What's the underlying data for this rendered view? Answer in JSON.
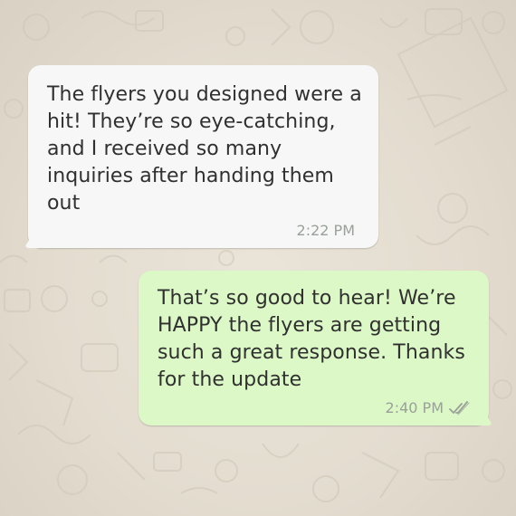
{
  "messages": [
    {
      "direction": "incoming",
      "text": "The flyers you designed were a hit! They’re so eye-catching, and I received so many inquiries after handing them out",
      "time": "2:22 PM"
    },
    {
      "direction": "outgoing",
      "text": "That’s so good to hear! We’re HAPPY the flyers are getting such a great response. Thanks for the update",
      "time": "2:40 PM",
      "status_icon": "double-check-icon"
    }
  ],
  "colors": {
    "incoming_bubble": "#f7f7f7",
    "outgoing_bubble": "#dcf8c6",
    "background": "#e5ddd0",
    "timestamp": "#9aa09a",
    "read_check": "#9aa09a"
  }
}
